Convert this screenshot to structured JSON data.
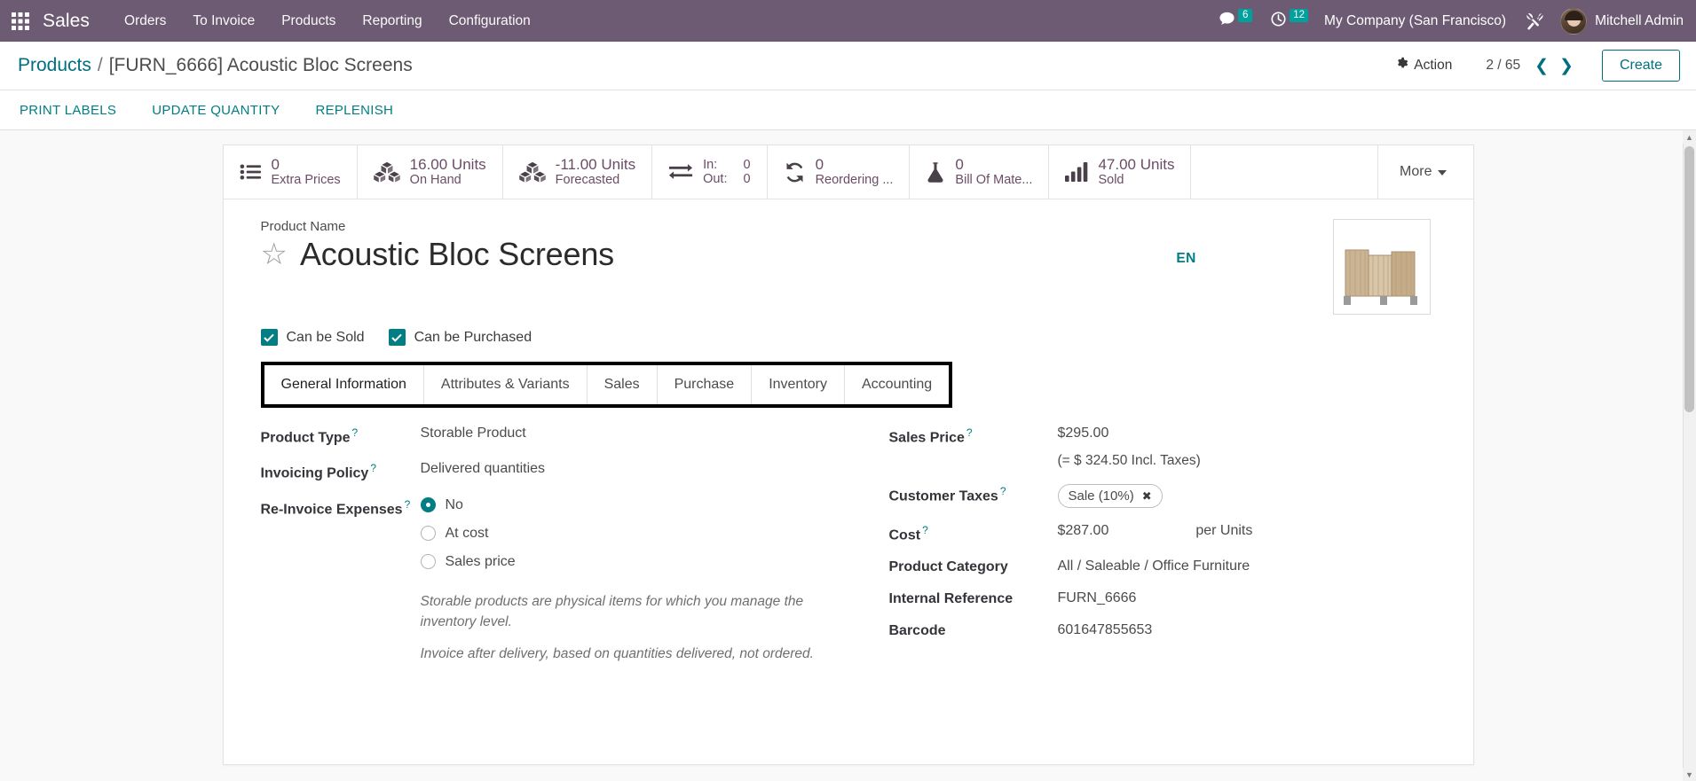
{
  "navbar": {
    "apps_icon": "apps-grid-icon",
    "brand": "Sales",
    "menu": [
      {
        "label": "Orders"
      },
      {
        "label": "To Invoice"
      },
      {
        "label": "Products"
      },
      {
        "label": "Reporting"
      },
      {
        "label": "Configuration"
      }
    ],
    "messages": {
      "icon": "chat-bubble-icon",
      "count": "6"
    },
    "activities": {
      "icon": "clock-icon",
      "count": "12"
    },
    "company": "My Company (San Francisco)",
    "tools_icon": "tools-icon",
    "user": {
      "name": "Mitchell Admin",
      "avatar": "user-avatar"
    },
    "accent": "#00a09d",
    "background": "#6d5b74"
  },
  "control_panel": {
    "breadcrumb_root": "Products",
    "breadcrumb_separator": "/",
    "breadcrumb_current": "[FURN_6666] Acoustic Bloc Screens",
    "action_label": "Action",
    "action_icon": "gear-icon",
    "pager": "2 / 65",
    "prev_icon": "chevron-left-icon",
    "next_icon": "chevron-right-icon",
    "create_label": "Create"
  },
  "action_buttons": [
    {
      "label": "PRINT LABELS"
    },
    {
      "label": "UPDATE QUANTITY"
    },
    {
      "label": "REPLENISH"
    }
  ],
  "stat_buttons": [
    {
      "icon": "list-icon",
      "value": "0",
      "label": "Extra Prices"
    },
    {
      "icon": "boxes-icon",
      "value": "16.00 Units",
      "label": "On Hand"
    },
    {
      "icon": "boxes-icon",
      "value": "-11.00 Units",
      "label": "Forecasted"
    },
    {
      "icon": "exchange-arrows-icon",
      "in_label": "In:",
      "in_value": "0",
      "out_label": "Out:",
      "out_value": "0"
    },
    {
      "icon": "refresh-icon",
      "value": "0",
      "label": "Reordering ..."
    },
    {
      "icon": "flask-icon",
      "value": "0",
      "label": "Bill Of Mate..."
    },
    {
      "icon": "bar-chart-icon",
      "value": "47.00 Units",
      "label": "Sold"
    }
  ],
  "more_button": {
    "label": "More",
    "icon": "caret-down-icon"
  },
  "product": {
    "name_label": "Product Name",
    "name": "Acoustic Bloc Screens",
    "star_icon": "star-outline-icon",
    "language_badge": "EN",
    "image_icon": "product-image",
    "can_be_sold": {
      "label": "Can be Sold",
      "checked": true
    },
    "can_be_purchased": {
      "label": "Can be Purchased",
      "checked": true
    }
  },
  "tabs": [
    {
      "label": "General Information",
      "active": true
    },
    {
      "label": "Attributes & Variants",
      "active": false
    },
    {
      "label": "Sales",
      "active": false
    },
    {
      "label": "Purchase",
      "active": false
    },
    {
      "label": "Inventory",
      "active": false
    },
    {
      "label": "Accounting",
      "active": false
    }
  ],
  "form": {
    "left": {
      "product_type_label": "Product Type",
      "product_type_value": "Storable Product",
      "invoicing_policy_label": "Invoicing Policy",
      "invoicing_policy_value": "Delivered quantities",
      "reinvoice_label": "Re-Invoice Expenses",
      "reinvoice_options": [
        {
          "label": "No",
          "selected": true
        },
        {
          "label": "At cost",
          "selected": false
        },
        {
          "label": "Sales price",
          "selected": false
        }
      ],
      "hint_1": "Storable products are physical items for which you manage the inventory level.",
      "hint_2": "Invoice after delivery, based on quantities delivered, not ordered."
    },
    "right": {
      "sales_price_label": "Sales Price",
      "sales_price_value": "$295.00",
      "sales_price_incl": "(= $ 324.50 Incl. Taxes)",
      "customer_taxes_label": "Customer Taxes",
      "customer_taxes_tag": "Sale (10%)",
      "customer_taxes_tag_remove": "remove-tag-icon",
      "cost_label": "Cost",
      "cost_value": "$287.00",
      "cost_uom": "per Units",
      "product_category_label": "Product Category",
      "product_category_value": "All / Saleable / Office Furniture",
      "internal_reference_label": "Internal Reference",
      "internal_reference_value": "FURN_6666",
      "barcode_label": "Barcode",
      "barcode_value": "601647855653"
    },
    "help_icon": "question-mark-icon"
  },
  "scrollbar": {
    "up_icon": "scroll-up-icon",
    "down_icon": "scroll-down-icon"
  }
}
